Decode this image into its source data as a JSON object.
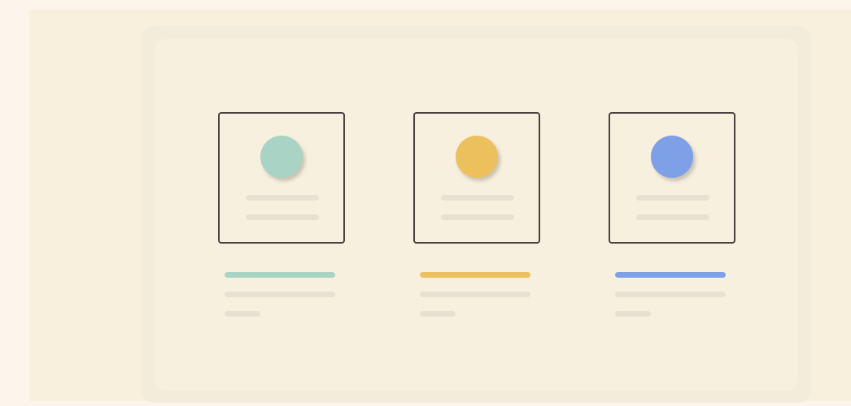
{
  "colors": {
    "background": "#fdf5ec",
    "stage": "#f8f0dd",
    "panel_outer": "#f4ecdb",
    "panel_inner": "#f8f0df",
    "card_border": "#4a4140",
    "placeholder": "#e8e1d2"
  },
  "cards": [
    {
      "id": "teal",
      "accent": "#a9d4c5"
    },
    {
      "id": "gold",
      "accent": "#edc05e"
    },
    {
      "id": "blue",
      "accent": "#7ea0e6"
    }
  ]
}
